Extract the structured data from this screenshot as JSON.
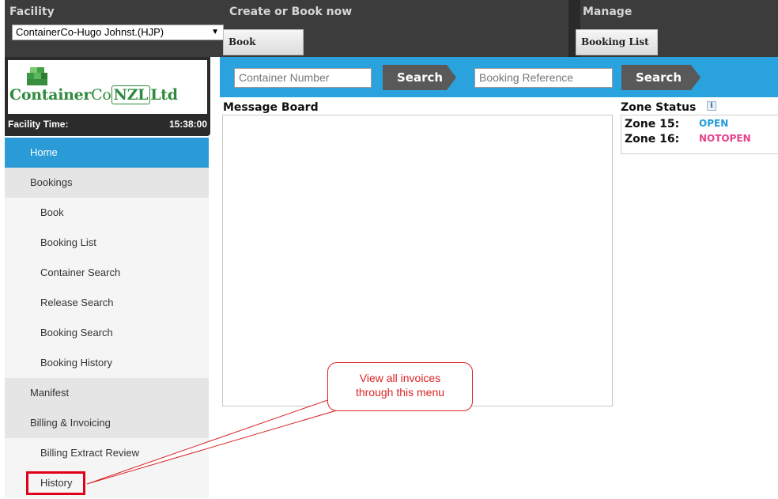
{
  "header": {
    "facility_label": "Facility",
    "facility_selected": "ContainerCo-Hugo Johnst.(HJP)",
    "create_label": "Create or Book now",
    "book_button": "Book",
    "manage_label": "Manage",
    "booking_list_button": "Booking List"
  },
  "logo": {
    "name_part1": "Container",
    "name_part2": "Co",
    "name_part3": "NZL",
    "name_part4": "Ltd"
  },
  "facility_time": {
    "label": "Facility Time:",
    "value": "15:38:00"
  },
  "menu": {
    "items": [
      {
        "label": "Home"
      },
      {
        "label": "Bookings"
      },
      {
        "label": "Book"
      },
      {
        "label": "Booking List"
      },
      {
        "label": "Container Search"
      },
      {
        "label": "Release Search"
      },
      {
        "label": "Booking Search"
      },
      {
        "label": "Booking History"
      },
      {
        "label": "Manifest"
      },
      {
        "label": "Billing & Invoicing"
      },
      {
        "label": "Billing Extract Review"
      },
      {
        "label": "History"
      }
    ]
  },
  "search": {
    "container_placeholder": "Container Number",
    "booking_placeholder": "Booking Reference",
    "search_button": "Search"
  },
  "message_board": {
    "title": "Message Board"
  },
  "zone_status": {
    "title": "Zone Status",
    "info_icon": "i",
    "zones": [
      {
        "name": "Zone 15:",
        "status": "OPEN",
        "color": "#1f9bd7"
      },
      {
        "name": "Zone 16:",
        "status": "NOTOPEN",
        "color": "#e8408a"
      }
    ]
  },
  "callout": {
    "line1": "View all invoices",
    "line2": "through this menu"
  },
  "colors": {
    "accent_blue": "#2aa2de",
    "header_dark": "#3c3c3c",
    "callout_red": "#d92424"
  }
}
